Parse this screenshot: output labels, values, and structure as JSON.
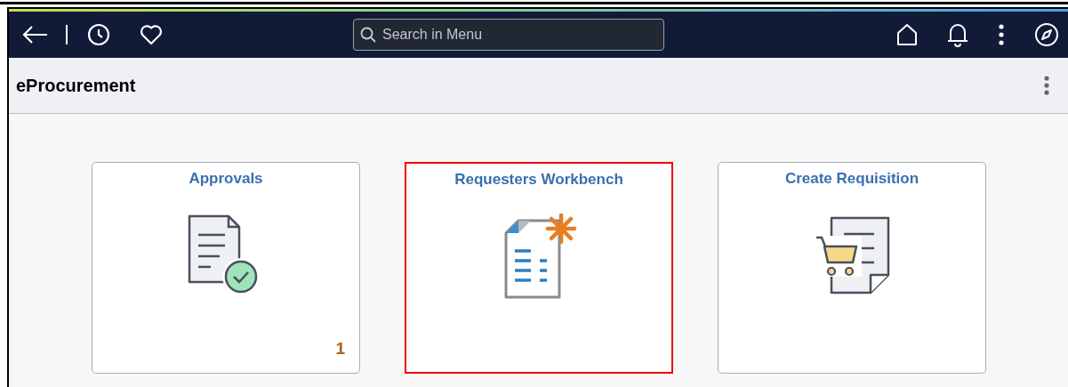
{
  "search": {
    "placeholder": "Search in Menu"
  },
  "page": {
    "title": "eProcurement"
  },
  "tiles": [
    {
      "title": "Approvals",
      "highlighted": false,
      "count": "1"
    },
    {
      "title": "Requesters Workbench",
      "highlighted": true
    },
    {
      "title": "Create Requisition",
      "highlighted": false
    }
  ]
}
